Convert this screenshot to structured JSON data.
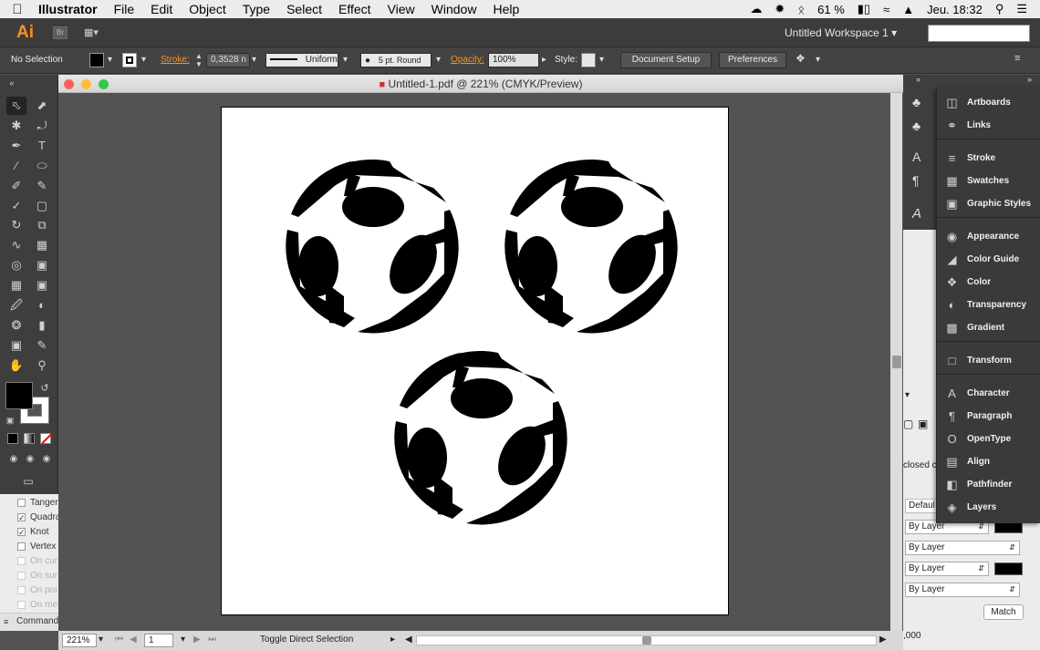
{
  "menubar": {
    "app_name": "Illustrator",
    "items": [
      "File",
      "Edit",
      "Object",
      "Type",
      "Select",
      "Effect",
      "View",
      "Window",
      "Help"
    ],
    "battery": "61 %",
    "clock": "Jeu. 18:32"
  },
  "appbar": {
    "logo": "Ai",
    "bridge": "Br",
    "workspace": "Untitled Workspace 1"
  },
  "control": {
    "selection": "No Selection",
    "stroke_label": "Stroke:",
    "stroke_value": "0,3528 n",
    "profile": "Uniform",
    "brush": "5 pt. Round",
    "opacity_label": "Opacity:",
    "opacity_value": "100%",
    "style_label": "Style:",
    "document_setup": "Document Setup",
    "preferences": "Preferences"
  },
  "document": {
    "title": "Untitled-1.pdf @ 221% (CMYK/Preview)",
    "zoom": "221%",
    "page": "1",
    "status": "Toggle Direct Selection"
  },
  "tools": [
    "selection-tool",
    "direct-selection-tool",
    "magic-wand-tool",
    "lasso-tool",
    "pen-tool",
    "type-tool",
    "line-tool",
    "ellipse-tool",
    "paintbrush-tool",
    "pencil-tool",
    "shaper-tool",
    "eraser-tool",
    "rotate-tool",
    "scale-tool",
    "width-tool",
    "free-transform-tool",
    "shape-builder-tool",
    "perspective-grid-tool",
    "mesh-tool",
    "gradient-tool",
    "eyedropper-tool",
    "blend-tool",
    "symbol-sprayer-tool",
    "column-graph-tool",
    "artboard-tool",
    "slice-tool",
    "hand-tool",
    "zoom-tool"
  ],
  "smart_guides": [
    {
      "label": "Tanger",
      "checked": false,
      "enabled": true
    },
    {
      "label": "Quadra",
      "checked": true,
      "enabled": true
    },
    {
      "label": "Knot",
      "checked": true,
      "enabled": true
    },
    {
      "label": "Vertex",
      "checked": false,
      "enabled": true
    },
    {
      "label": "On cur",
      "checked": false,
      "enabled": false
    },
    {
      "label": "On sur",
      "checked": false,
      "enabled": false
    },
    {
      "label": "On poi",
      "checked": false,
      "enabled": false
    },
    {
      "label": "On me",
      "checked": false,
      "enabled": false
    }
  ],
  "left_bottom_label": "Command",
  "right_panel": {
    "closed_label": "closed c",
    "default_label": "Defaul",
    "by_layer": [
      "By Layer",
      "By Layer",
      "By Layer",
      "By Layer"
    ],
    "match_button": "Match",
    "bottom_value": ",000"
  },
  "dock_panels": [
    {
      "label": "Artboards",
      "icon": "artboards-icon"
    },
    {
      "label": "Links",
      "icon": "links-icon"
    },
    {
      "label": "Stroke",
      "icon": "stroke-icon"
    },
    {
      "label": "Swatches",
      "icon": "swatches-icon"
    },
    {
      "label": "Graphic Styles",
      "icon": "graphic-styles-icon"
    },
    {
      "label": "Appearance",
      "icon": "appearance-icon"
    },
    {
      "label": "Color Guide",
      "icon": "color-guide-icon"
    },
    {
      "label": "Color",
      "icon": "color-icon"
    },
    {
      "label": "Transparency",
      "icon": "transparency-icon"
    },
    {
      "label": "Gradient",
      "icon": "gradient-icon"
    },
    {
      "label": "Transform",
      "icon": "transform-icon"
    },
    {
      "label": "Character",
      "icon": "character-icon"
    },
    {
      "label": "Paragraph",
      "icon": "paragraph-icon"
    },
    {
      "label": "OpenType",
      "icon": "opentype-icon"
    },
    {
      "label": "Align",
      "icon": "align-icon"
    },
    {
      "label": "Pathfinder",
      "icon": "pathfinder-icon"
    },
    {
      "label": "Layers",
      "icon": "layers-icon"
    }
  ],
  "colors": {
    "accent": "#f7931e",
    "fill": "#000000",
    "stroke": "#ffffff"
  }
}
